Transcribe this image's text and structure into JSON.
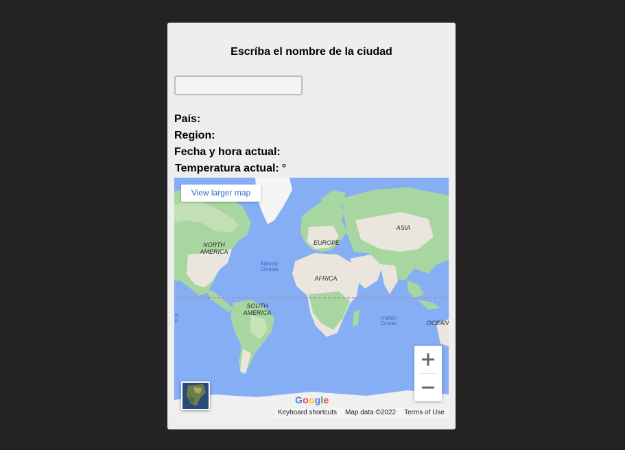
{
  "form": {
    "title": "Escríba el nombre de la ciudad",
    "city_value": "",
    "city_placeholder": ""
  },
  "info": {
    "country_label": "País:",
    "country_value": "",
    "region_label": "Region:",
    "region_value": "",
    "datetime_label": "Fecha y hora actual:",
    "datetime_value": "",
    "temperature_label": "Temperatura actual:",
    "temperature_value": "°"
  },
  "map": {
    "larger_map_label": "View larger map",
    "zoom_in_icon": "plus-icon",
    "zoom_out_icon": "minus-icon",
    "layer_icon": "satellite-thumbnail",
    "logo_text": "Google",
    "footer": {
      "keyboard_shortcuts": "Keyboard shortcuts",
      "map_data": "Map data ©2022",
      "terms": "Terms of Use"
    },
    "labels": {
      "north_america": [
        "NORTH",
        "AMERICA"
      ],
      "south_america": [
        "SOUTH",
        "AMERICA"
      ],
      "europe": "EUROPE",
      "africa": "AFRICA",
      "asia": "ASIA",
      "atlantic": [
        "Atlantic",
        "Ocean"
      ],
      "indian": [
        "Indian",
        "Ocean"
      ],
      "ocean_right": "OCEAN",
      "edge_left": [
        "ic",
        "n"
      ]
    },
    "colors": {
      "water": "#86aef5",
      "land": "#eae6de",
      "forest": "#a8d6a0",
      "ice": "#f5f5f5"
    }
  }
}
